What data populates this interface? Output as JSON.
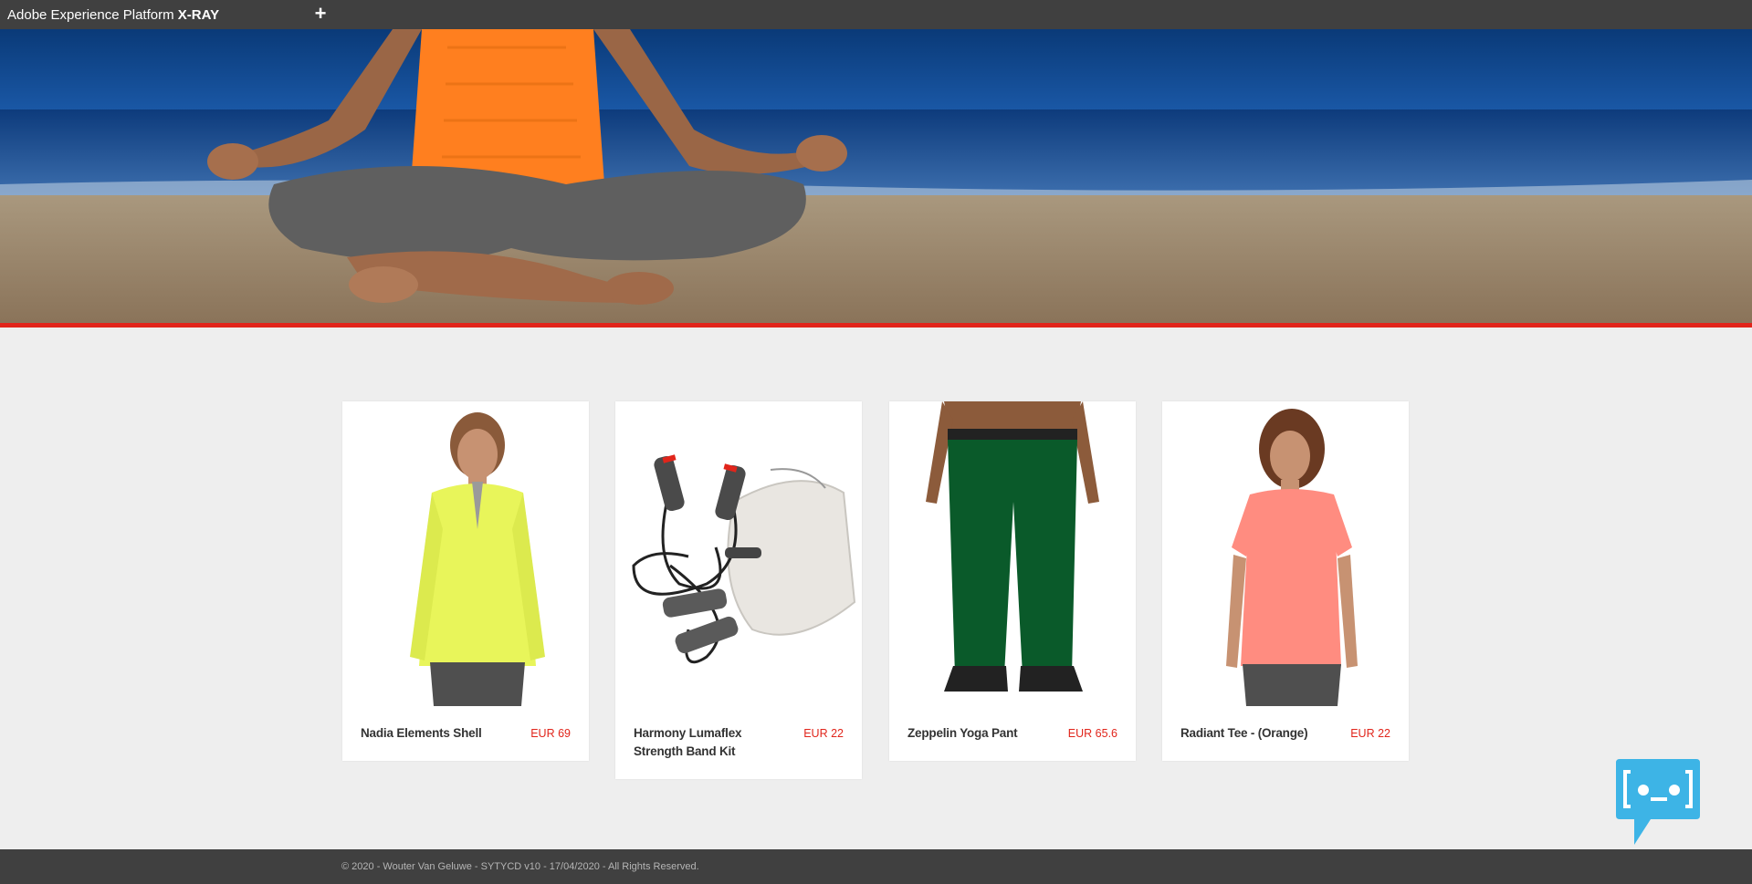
{
  "app": {
    "brand_prefix": "Adobe Experience Platform",
    "brand_name": "X-RAY",
    "add_icon": "plus-icon",
    "add_label": "+"
  },
  "hero": {
    "image": "yoga-beach-banner",
    "accent_color": "#e1251b"
  },
  "products": [
    {
      "name": "Nadia Elements Shell",
      "price": "EUR 69",
      "image": "woman-yellow-quarter-zip"
    },
    {
      "name": "Harmony Lumaflex Strength Band Kit",
      "price": "EUR 22",
      "image": "jump-rope-band-kit"
    },
    {
      "name": "Zeppelin Yoga Pant",
      "price": "EUR 65.6",
      "image": "man-green-pants"
    },
    {
      "name": "Radiant Tee - (Orange)",
      "price": "EUR 22",
      "image": "woman-coral-tee"
    }
  ],
  "footer": {
    "copyright": "© 2020 - Wouter Van Geluwe - SYTYCD v10 - 17/04/2020 - All Rights Reserved."
  },
  "chatbot": {
    "icon": "chatbot-icon",
    "color": "#3db4e6"
  }
}
